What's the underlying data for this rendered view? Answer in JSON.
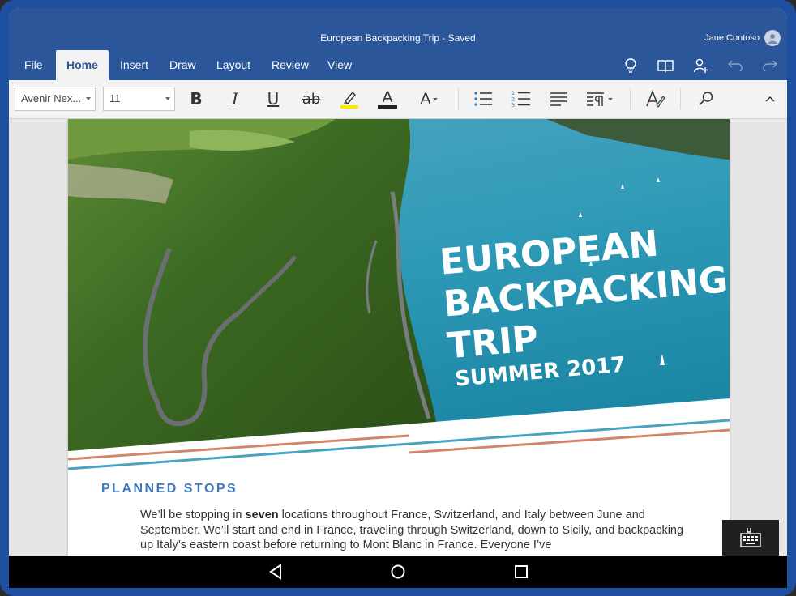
{
  "app": {
    "document_title": "European Backpacking Trip - Saved",
    "user_name": "Jane Contoso"
  },
  "ribbon": {
    "tabs": [
      {
        "label": "File",
        "active": false
      },
      {
        "label": "Home",
        "active": true
      },
      {
        "label": "Insert",
        "active": false
      },
      {
        "label": "Draw",
        "active": false
      },
      {
        "label": "Layout",
        "active": false
      },
      {
        "label": "Review",
        "active": false
      },
      {
        "label": "View",
        "active": false
      }
    ],
    "right_icons": [
      "lightbulb-icon",
      "book-icon",
      "share-person-icon",
      "undo-icon",
      "redo-icon"
    ]
  },
  "toolbar": {
    "font_name": "Avenir Nex...",
    "font_size": "11",
    "bold_label": "B",
    "italic_label": "I",
    "underline_label": "U",
    "strikethrough_label": "ab",
    "font_color_label": "A",
    "font_size_label": "A",
    "highlight_color": "#ffe800",
    "font_color": "#222222"
  },
  "document": {
    "hero_title_lines": [
      "EUROPEAN",
      "BACKPACKING",
      "TRIP"
    ],
    "hero_subtitle": "SUMMER 2017",
    "section_heading": "PLANNED STOPS",
    "paragraph_before_bold": "We’ll be stopping in ",
    "paragraph_bold": "seven",
    "paragraph_after_bold": " locations throughout France, Switzerland, and Italy between June and September. We’ll start and end in France, traveling through Switzerland, down to Sicily, and backpacking up Italy’s eastern coast before returning to Mont Blanc in France. Everyone I’ve"
  },
  "colors": {
    "ribbon_blue": "#2b579a",
    "heading_blue": "#3e78bf",
    "stripe_orange": "#d0866a",
    "stripe_teal": "#4aa3c3"
  }
}
